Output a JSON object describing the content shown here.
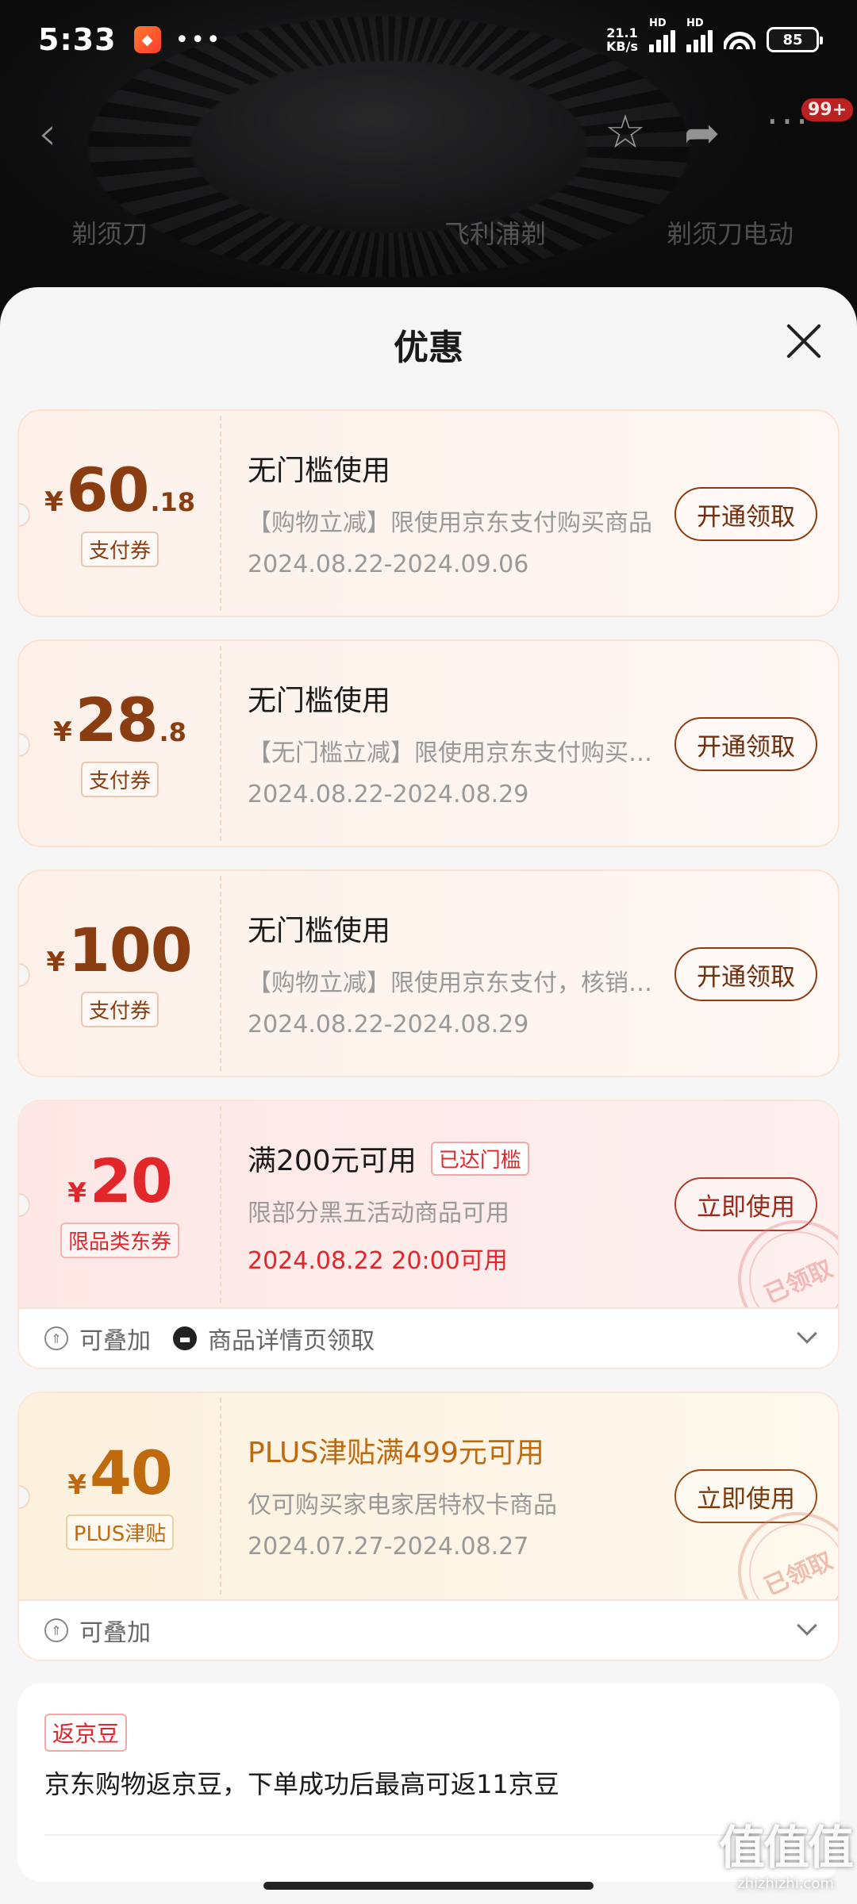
{
  "status_bar": {
    "time": "5:33",
    "more": "•••",
    "net_speed_value": "21.1",
    "net_speed_unit": "KB/s",
    "sim1_label": "HD",
    "sim2_label": "HD",
    "battery": "85"
  },
  "nav": {
    "badge": "99+"
  },
  "background_tabs": [
    "剃须刀",
    "飞利浦剃",
    "剃须刀电动"
  ],
  "sheet": {
    "title": "优惠"
  },
  "coupons": [
    {
      "currency": "¥",
      "amount_int": "60",
      "amount_dec": ".18",
      "type_label": "支付券",
      "title": "无门槛使用",
      "desc": "【购物立减】限使用京东支付购买商品",
      "date": "2024.08.22-2024.09.06",
      "action": "开通领取"
    },
    {
      "currency": "¥",
      "amount_int": "28",
      "amount_dec": ".8",
      "type_label": "支付券",
      "title": "无门槛使用",
      "desc": "【无门槛立减】限使用京东支付购买商品",
      "date": "2024.08.22-2024.08.29",
      "action": "开通领取"
    },
    {
      "currency": "¥",
      "amount_int": "100",
      "amount_dec": "",
      "type_label": "支付券",
      "title": "无门槛使用",
      "desc": "【购物立减】限使用京东支付，核销后可用",
      "date": "2024.08.22-2024.08.29",
      "action": "开通领取"
    },
    {
      "currency": "¥",
      "amount_int": "20",
      "amount_dec": "",
      "type_label": "限品类东券",
      "title": "满200元可用",
      "reached_tag": "已达门槛",
      "desc": "限部分黑五活动商品可用",
      "date": "2024.08.22 20:00可用",
      "action": "立即使用",
      "stamp": "已领取",
      "footer_stack": "可叠加",
      "footer_source": "商品详情页领取"
    },
    {
      "currency": "¥",
      "amount_int": "40",
      "amount_dec": "",
      "type_label": "PLUS津贴",
      "title": "PLUS津贴满499元可用",
      "desc": "仅可购买家电家居特权卡商品",
      "date": "2024.07.27-2024.08.27",
      "action": "立即使用",
      "stamp": "已领取",
      "footer_stack": "可叠加"
    }
  ],
  "bean": {
    "tag": "返京豆",
    "text": "京东购物返京豆，下单成功后最高可返11京豆"
  },
  "watermark": {
    "logo": "值值值",
    "site": "zhizhizhi.com"
  },
  "colors": {
    "brown": "#8b3d12",
    "red": "#e2262a",
    "gold": "#c06a10"
  }
}
